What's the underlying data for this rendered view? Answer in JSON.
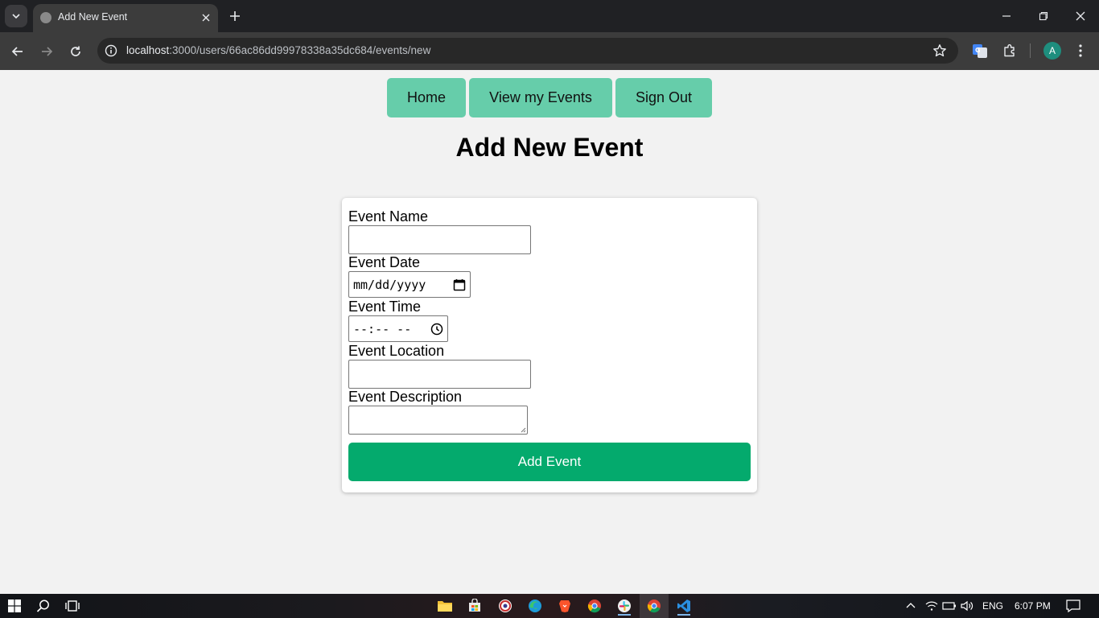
{
  "browser": {
    "tab_title": "Add New Event",
    "url_host": "localhost",
    "url_path": ":3000/users/66ac86dd99978338a35dc684/events/new",
    "profile_initial": "A"
  },
  "page": {
    "nav": [
      {
        "label": "Home"
      },
      {
        "label": "View my Events"
      },
      {
        "label": "Sign Out"
      }
    ],
    "heading": "Add New Event",
    "form": {
      "name_label": "Event Name",
      "name_value": "",
      "date_label": "Event Date",
      "date_placeholder": "mm/dd/yyyy",
      "time_label": "Event Time",
      "time_placeholder": "--:-- --",
      "location_label": "Event Location",
      "location_value": "",
      "description_label": "Event Description",
      "description_value": "",
      "submit_label": "Add Event"
    }
  },
  "taskbar": {
    "language": "ENG",
    "time": "6:07 PM"
  },
  "colors": {
    "nav_button": "#66cdaa",
    "submit_button": "#04aa6d",
    "page_background": "#f2f2f2"
  }
}
